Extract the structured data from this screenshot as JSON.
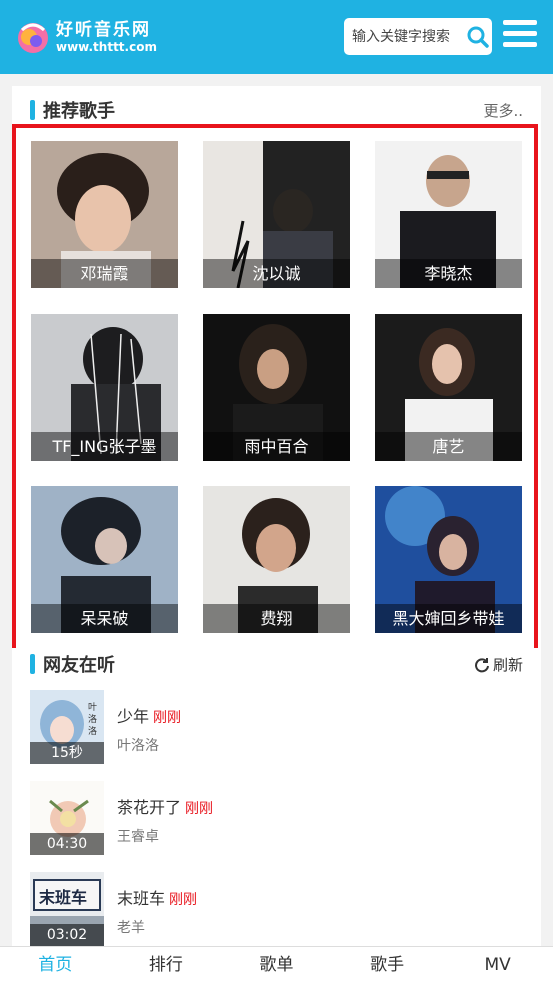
{
  "header": {
    "logo_name": "好听音乐网",
    "logo_url": "www.thttt.com",
    "search_placeholder": "输入关键字搜索"
  },
  "singers_section": {
    "title": "推荐歌手",
    "more": "更多..",
    "items": [
      {
        "name": "邓瑞霞"
      },
      {
        "name": "沈以诚"
      },
      {
        "name": "李晓杰"
      },
      {
        "name": "TF_ING张子墨"
      },
      {
        "name": "雨中百合"
      },
      {
        "name": "唐艺"
      },
      {
        "name": "呆呆破"
      },
      {
        "name": "费翔"
      },
      {
        "name": "黑大婶回乡带娃"
      }
    ]
  },
  "listening_section": {
    "title": "网友在听",
    "refresh": "刷新",
    "tracks": [
      {
        "title": "少年",
        "time": "刚刚",
        "artist": "叶洛洛",
        "duration": "15秒"
      },
      {
        "title": "茶花开了",
        "time": "刚刚",
        "artist": "王睿卓",
        "duration": "04:30"
      },
      {
        "title": "末班车",
        "time": "刚刚",
        "artist": "老羊",
        "duration": "03:02"
      }
    ]
  },
  "tabbar": {
    "items": [
      "首页",
      "排行",
      "歌单",
      "歌手",
      "MV"
    ],
    "active": "首页"
  },
  "colors": {
    "brand": "#1fb2e2",
    "highlight": "#e8141c"
  }
}
